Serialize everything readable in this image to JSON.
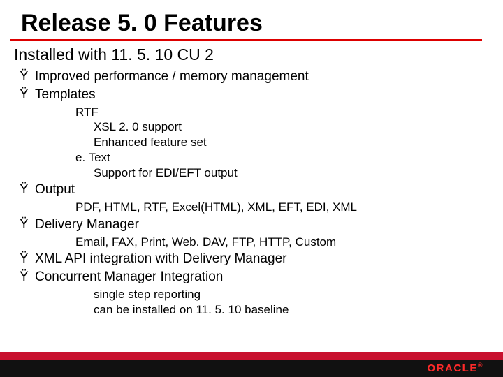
{
  "title": "Release 5. 0 Features",
  "subtitle": "Installed with 11. 5. 10 CU 2",
  "bullets": [
    {
      "glyph": "Ÿ",
      "text": "Improved performance / memory management"
    },
    {
      "glyph": "Ÿ",
      "text": "Templates",
      "sub": [
        "RTF",
        "XSL 2. 0 support",
        "Enhanced feature set",
        "e. Text",
        "Support for EDI/EFT output"
      ]
    },
    {
      "glyph": "Ÿ",
      "text": "Output",
      "sub": [
        "PDF, HTML, RTF, Excel(HTML), XML, EFT, EDI, XML"
      ]
    },
    {
      "glyph": "Ÿ",
      "text": "Delivery Manager",
      "sub": [
        "Email, FAX, Print, Web. DAV, FTP, HTTP, Custom"
      ]
    },
    {
      "glyph": "Ÿ",
      "text": "XML API integration with Delivery Manager"
    },
    {
      "glyph": "Ÿ",
      "text": "Concurrent Manager Integration",
      "sub": [
        "single step reporting",
        "can be installed on 11. 5. 10 baseline"
      ]
    }
  ],
  "footer": {
    "logo": "ORACLE",
    "logo_sup": "®"
  }
}
